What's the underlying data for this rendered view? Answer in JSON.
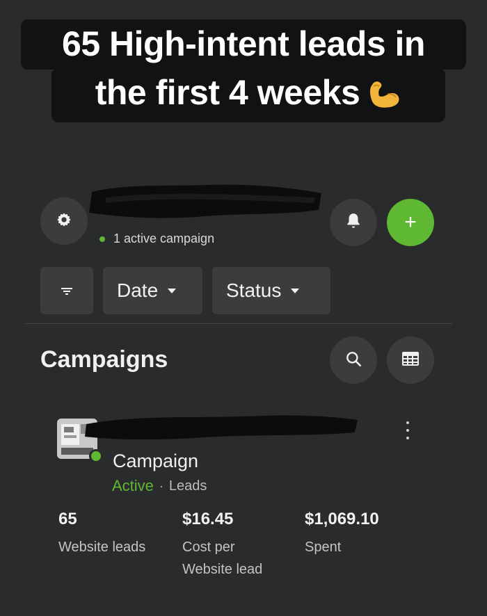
{
  "caption": {
    "line1": "65 High-intent leads in",
    "line2": "the first 4 weeks"
  },
  "header": {
    "active_count_text": "1 active campaign"
  },
  "filters": {
    "date_label": "Date",
    "status_label": "Status"
  },
  "campaigns": {
    "title": "Campaigns",
    "items": [
      {
        "name": "Campaign",
        "status": "Active",
        "separator": "·",
        "objective": "Leads",
        "metrics": [
          {
            "value": "65",
            "label": "Website leads"
          },
          {
            "value": "$16.45",
            "label": "Cost per Website lead"
          },
          {
            "value": "$1,069.10",
            "label": "Spent"
          }
        ]
      }
    ]
  },
  "colors": {
    "background": "#2a2b2d",
    "button": "#3b3c3e",
    "accent_green": "#5fb832",
    "caption_bg": "#111213"
  },
  "icons": [
    "gear-icon",
    "bell-icon",
    "plus-icon",
    "filter-icon",
    "chevron-down-icon",
    "search-icon",
    "table-icon",
    "more-vertical-icon",
    "flexed-biceps-icon"
  ]
}
